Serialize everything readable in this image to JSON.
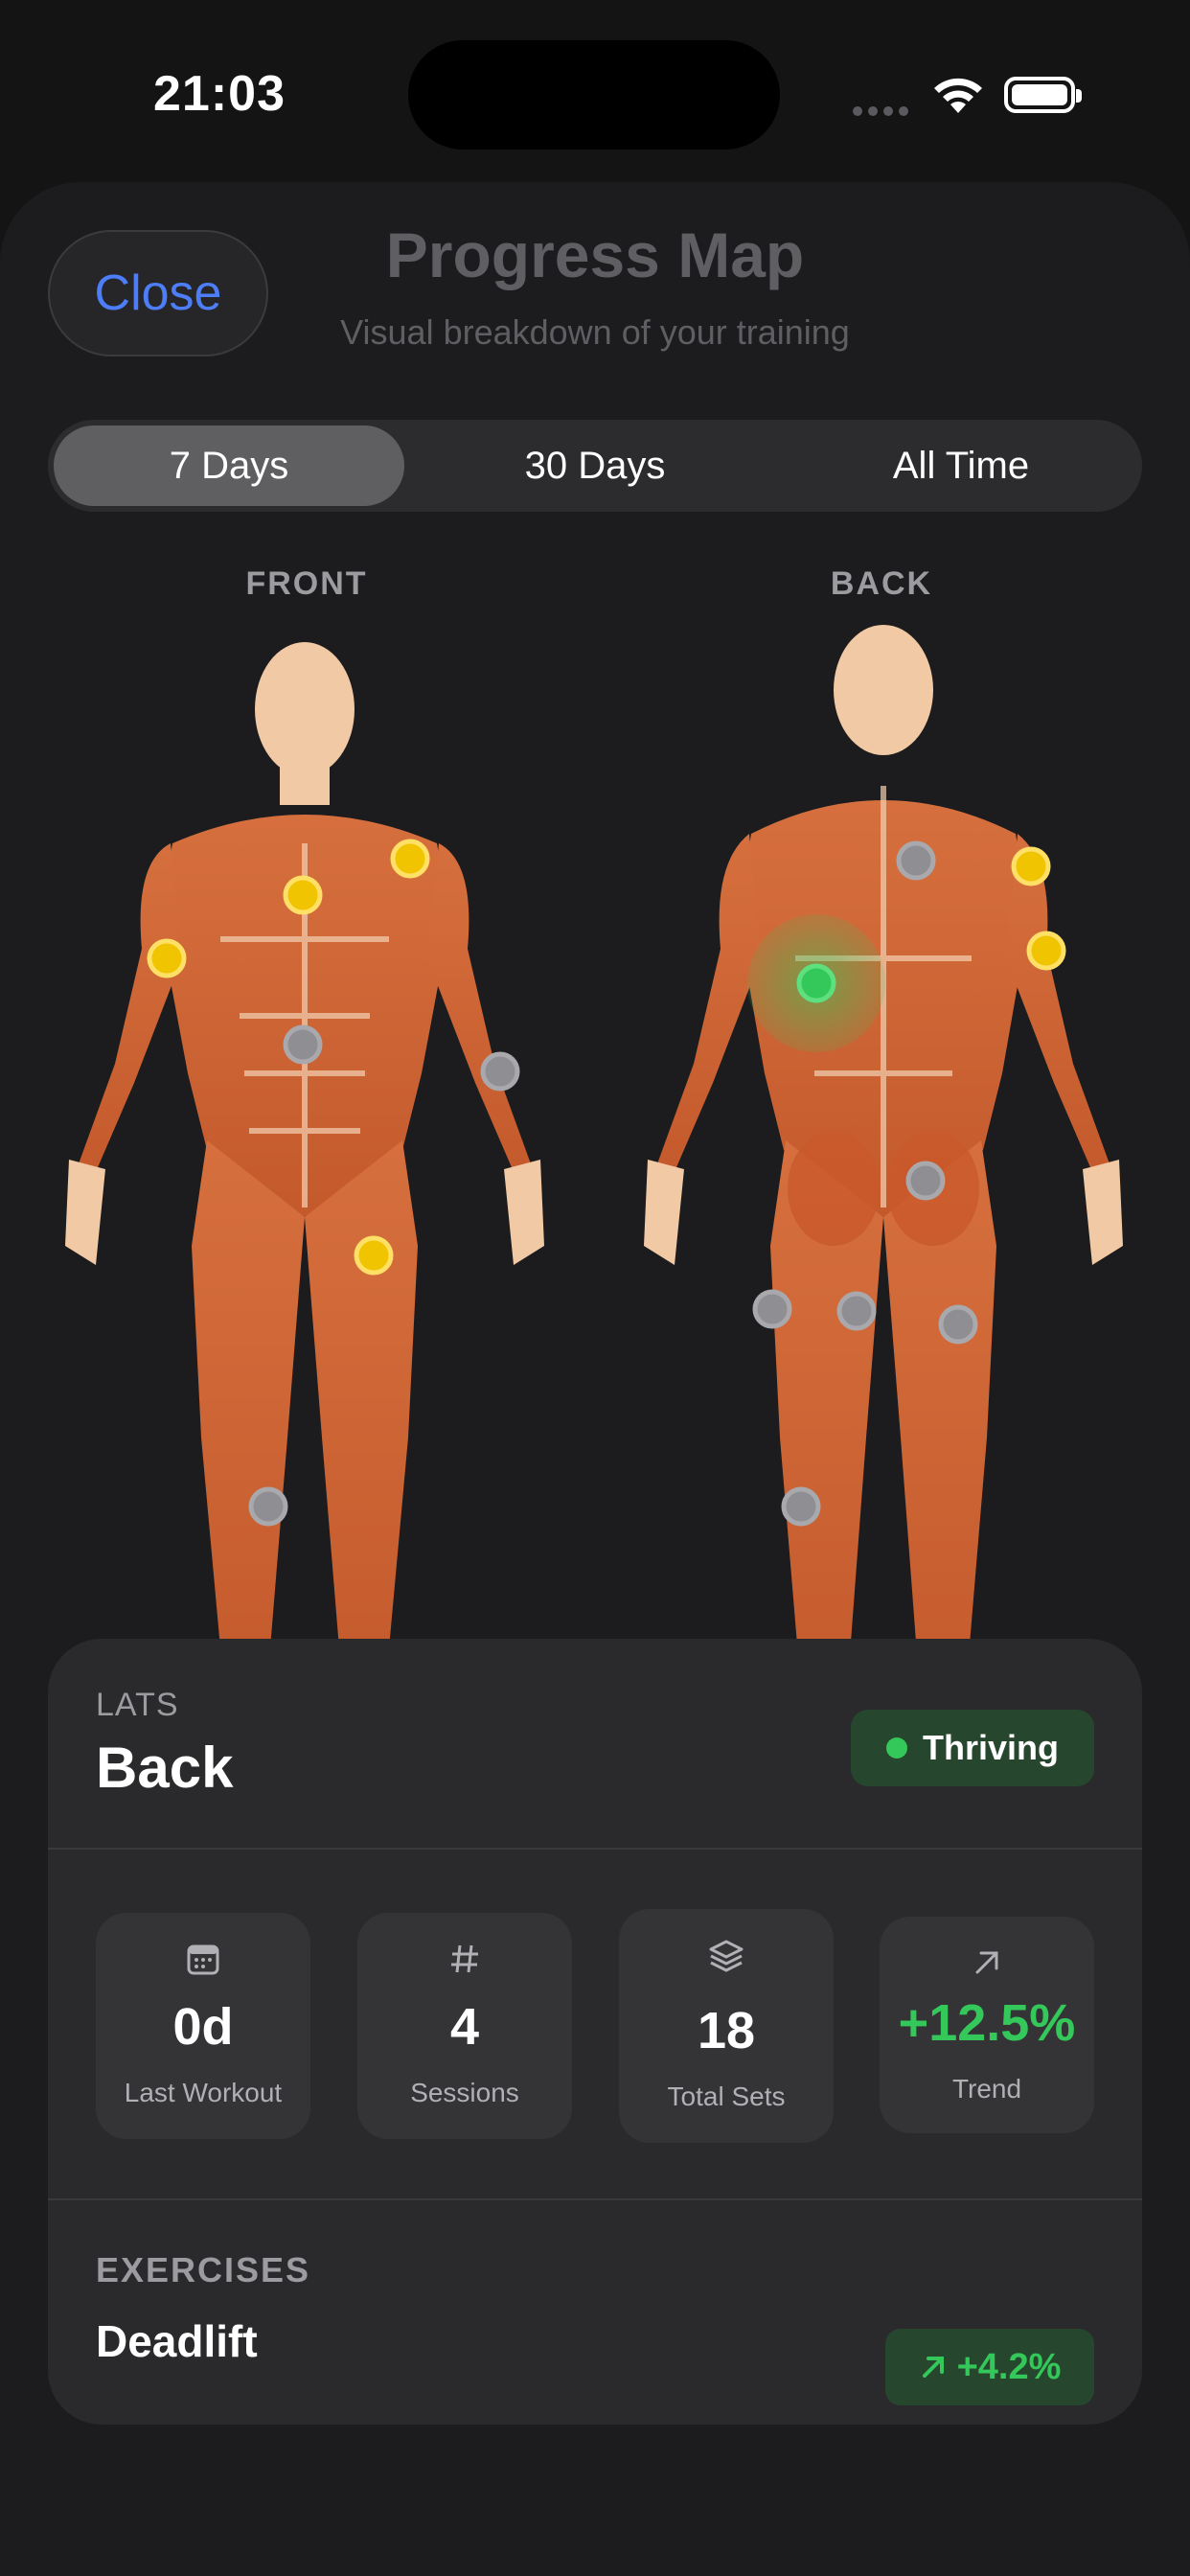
{
  "status_bar": {
    "time": "21:03"
  },
  "header": {
    "close_label": "Close",
    "title": "Progress Map",
    "subtitle": "Visual breakdown of your training"
  },
  "range_tabs": [
    {
      "label": "7 Days",
      "selected": true
    },
    {
      "label": "30 Days",
      "selected": false
    },
    {
      "label": "All Time",
      "selected": false
    }
  ],
  "body_map": {
    "front_label": "FRONT",
    "back_label": "BACK",
    "status_colors": {
      "thriving": "#34c759",
      "moderate": "#ffcc00",
      "inactive": "#8e8e93"
    }
  },
  "detail": {
    "category": "LATS",
    "muscle": "Back",
    "status_label": "Thriving",
    "stats": [
      {
        "icon": "calendar-icon",
        "value": "0d",
        "label": "Last Workout"
      },
      {
        "icon": "hash-icon",
        "value": "4",
        "label": "Sessions"
      },
      {
        "icon": "layers-icon",
        "value": "18",
        "label": "Total Sets"
      },
      {
        "icon": "arrow-up-right-icon",
        "value": "+12.5%",
        "label": "Trend"
      }
    ],
    "exercises_label": "EXERCISES",
    "exercises": [
      {
        "name": "Deadlift",
        "trend": "+4.2%"
      }
    ]
  },
  "colors": {
    "accent": "#4d7ef7",
    "positive": "#34c759",
    "background": "#1c1c1e"
  }
}
